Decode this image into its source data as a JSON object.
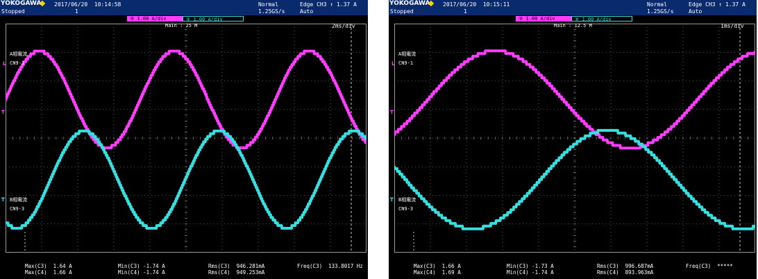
{
  "screens": [
    {
      "id": "left",
      "brand": "YOKOGAWA",
      "status": "Stopped",
      "datetime": "2017/06/20  10:14:58",
      "acq_count": "1",
      "mode": "Normal",
      "sample_rate": "1.25GS/s",
      "trigger": "Edge CH3 ↑ 1.37 A",
      "trigger_mode": "Auto",
      "ch3_scale": "③ 1.00 A/div",
      "ch4_scale": "④ 1.00 A/div",
      "main_label": "Main : 25 M",
      "time_div": "2ms/div",
      "trace_a_label": "A相電流",
      "trace_a_sub": "CN9-1",
      "trace_b_label": "B相電流",
      "trace_b_sub": "CN9-3",
      "measurements": {
        "row1": [
          "Max(C3)  1.64 A",
          "Min(C3) -1.74 A",
          "Rms(C3)  946.281mA",
          "Freq(C3)  133.8017 Hz"
        ],
        "row2": [
          "Max(C4)  1.66 A",
          "Min(C4) -1.74 A",
          "Rms(C4)  949.253mA",
          ""
        ]
      }
    },
    {
      "id": "right",
      "brand": "YOKOGAWA",
      "status": "Stopped",
      "datetime": "2017/06/20  10:15:11",
      "acq_count": "1",
      "mode": "Normal",
      "sample_rate": "1.25GS/s",
      "trigger": "Edge CH3 ↑ 1.37 A",
      "trigger_mode": "Auto",
      "ch3_scale": "③ 1.00 A/div",
      "ch4_scale": "④ 1.00 A/div",
      "main_label": "Main : 12.5 M",
      "time_div": "1ms/div",
      "trace_a_label": "A相電流",
      "trace_a_sub": "CN9-1",
      "trace_b_label": "B相電流",
      "trace_b_sub": "CN9-3",
      "measurements": {
        "row1": [
          "Max(C3)  1.66 A",
          "Min(C3) -1.73 A",
          "Rms(C3)  996.687mA",
          "Freq(C3)  *****"
        ],
        "row2": [
          "Max(C4)  1.69 A",
          "Min(C4) -1.74 A",
          "Rms(C4)  893.963mA",
          ""
        ]
      }
    }
  ],
  "colors": {
    "ch3": "#ff3cff",
    "ch4": "#36e0e0",
    "grid": "#9a9a9a",
    "header": "#0a2a6e"
  },
  "chart_data": [
    {
      "type": "line",
      "x_unit": "ms",
      "x_range": [
        0,
        20
      ],
      "y_unit": "A",
      "y_range": [
        -4,
        4
      ],
      "series": [
        {
          "channel": "CH3",
          "offset_div": 1.35,
          "amplitude_A": 1.69,
          "freq_hz": 133.8,
          "phase_deg": 0
        },
        {
          "channel": "CH4",
          "offset_div": -1.45,
          "amplitude_A": 1.7,
          "freq_hz": 133.8,
          "phase_deg": -120
        }
      ]
    },
    {
      "type": "line",
      "x_unit": "ms",
      "x_range": [
        0,
        10
      ],
      "y_unit": "A",
      "y_range": [
        -4,
        4
      ],
      "series": [
        {
          "channel": "CH3",
          "offset_div": 1.35,
          "amplitude_A": 1.7,
          "freq_hz": 133.8,
          "phase_deg": -45
        },
        {
          "channel": "CH4",
          "offset_div": -1.45,
          "amplitude_A": 1.72,
          "freq_hz": 133.8,
          "phase_deg": 165
        }
      ]
    }
  ]
}
